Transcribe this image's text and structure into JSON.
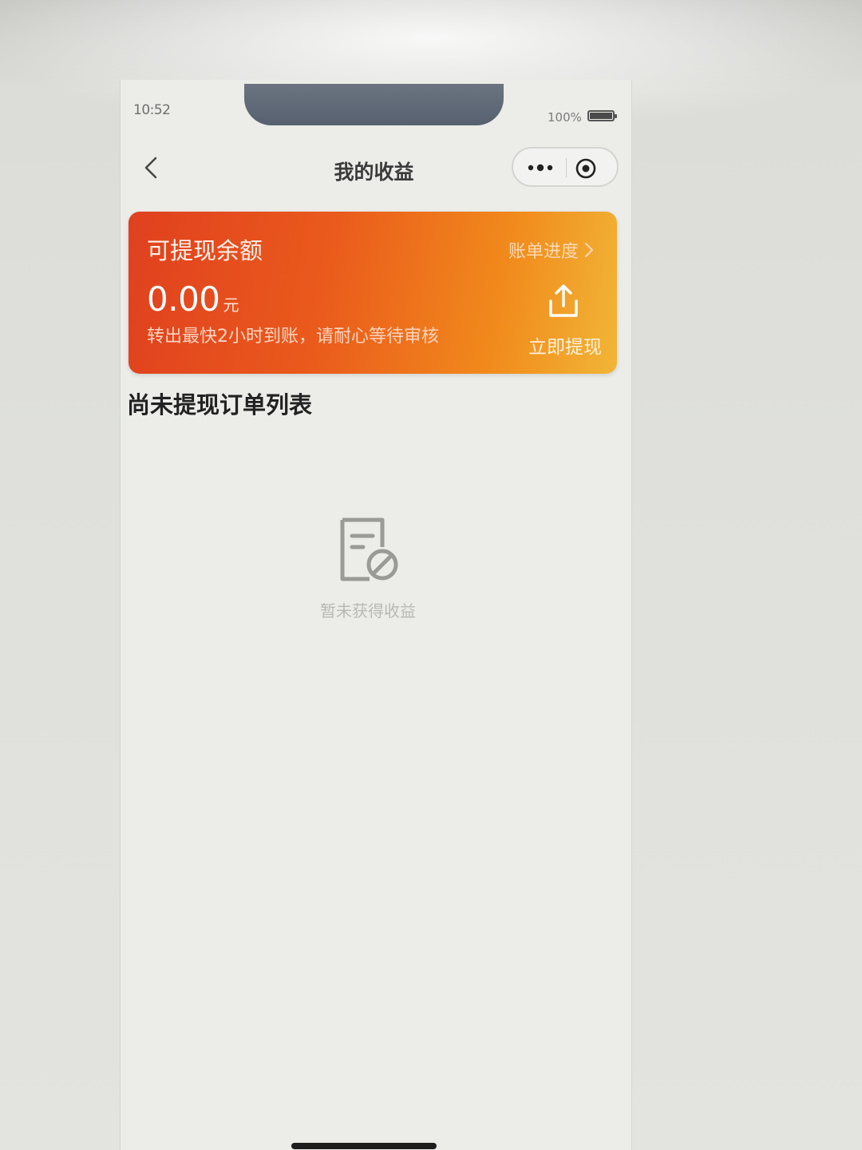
{
  "status_bar": {
    "time": "10:52",
    "battery_text": "100%"
  },
  "nav": {
    "title": "我的收益",
    "icons": {
      "back": "back-chevron-icon",
      "more": "more-dots-icon",
      "close": "mini-program-close-icon"
    }
  },
  "balance_card": {
    "title": "可提现余额",
    "bill_progress_label": "账单进度",
    "amount": "0.00",
    "unit": "元",
    "hint": "转出最快2小时到账，请耐心等待审核",
    "withdraw_label": "立即提现",
    "withdraw_icon": "upload-icon",
    "colors": {
      "gradient_start": "#e0401f",
      "gradient_end": "#f1b637"
    }
  },
  "list_section": {
    "title": "尚未提现订单列表",
    "empty_text": "暂未获得收益",
    "empty_icon": "document-disabled-icon"
  }
}
